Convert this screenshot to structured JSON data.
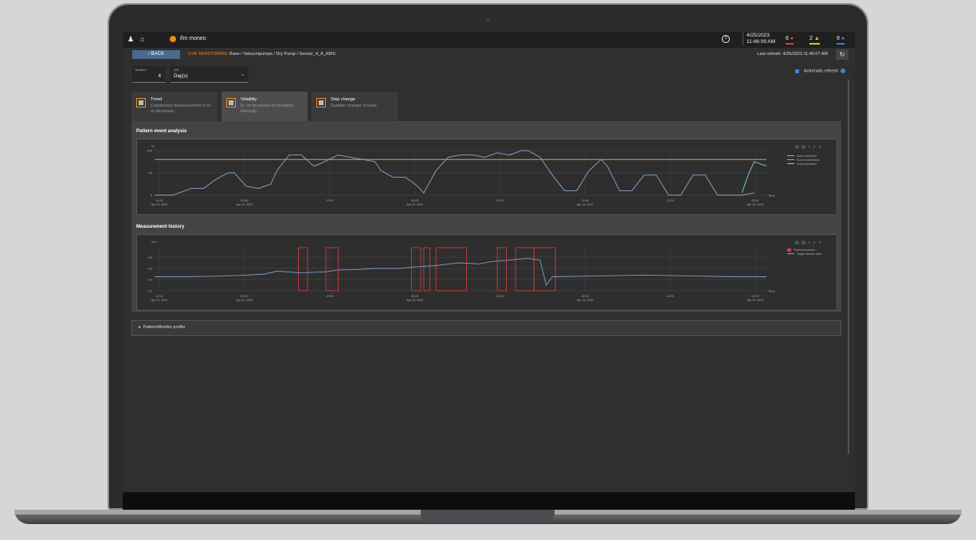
{
  "topbar": {
    "app_name": "ifm moneo",
    "date": "4/25/2023",
    "time": "11:46:09 AM",
    "alarm_red_count": "6",
    "alarm_yellow_count": "2",
    "alarm_blue_count": "9"
  },
  "subbar": {
    "back_label": "BACK",
    "live_label": "LIVE MONITORING:",
    "path": "Base / Vakuumpumpe / Dry Pump / Sensor_4_A_RMS",
    "last_refresh": "Last refresh: 4/25/2023 11:46:07 AM"
  },
  "filters": {
    "duration_label": "Duration*",
    "duration_value": "4",
    "unit_label": "Unit",
    "unit_value": "Day(s)",
    "auto_refresh_label": "Automatic refresh"
  },
  "tabs": [
    {
      "title": "Trend",
      "desc": "Continuous measurement of in- or decrease."
    },
    {
      "title": "Volatility",
      "desc": "In- or decrease of deviation intensity."
    },
    {
      "title": "Step change",
      "desc": "Sudden change of level."
    }
  ],
  "pattern_section": {
    "title": "Pattern event analysis"
  },
  "history_section": {
    "title": "Measurement history"
  },
  "profile": {
    "label": "PatternMonitor profile"
  },
  "icons": {
    "user": "user-icon",
    "home": "home-icon",
    "help": "help-icon",
    "alarm_red": "bell-icon",
    "alarm_yellow": "warning-icon",
    "alarm_blue": "info-icon",
    "back": "chevron-left-icon",
    "refresh": "refresh-icon",
    "tab": "pattern-icon",
    "expand": "triangle-right-icon"
  },
  "colors": {
    "accent": "#f08a1c",
    "alarm_threshold": "#e8a21c",
    "event_confirmation": "#8fa8c8",
    "event_prediction": "#7fd0e0",
    "threshold_alarms": "#e23b3b",
    "target_variable": "#7d9cc9"
  },
  "chart_data": [
    {
      "type": "line",
      "title": "Pattern event analysis",
      "ylabel": "%",
      "xlabel": "Time",
      "ylim": [
        0,
        100
      ],
      "yticks": [
        "100",
        "50",
        "0"
      ],
      "xticks": [
        {
          "time": "12:00",
          "date": "Apr 21, 2023"
        },
        {
          "time": "00:00",
          "date": "Apr 22, 2023"
        },
        {
          "time": "12:00",
          "date": ""
        },
        {
          "time": "00:00",
          "date": "Apr 23, 2023"
        },
        {
          "time": "12:00",
          "date": ""
        },
        {
          "time": "00:00",
          "date": "Apr 24, 2023"
        },
        {
          "time": "12:00",
          "date": ""
        },
        {
          "time": "00:00",
          "date": "Apr 25, 2023"
        }
      ],
      "legend": [
        "Alarm threshold",
        "Event confirmation",
        "Event prediction"
      ],
      "alarm_threshold": 80,
      "series": [
        {
          "name": "Event confirmation",
          "x": [
            0,
            3,
            6,
            8,
            10,
            12,
            13,
            15,
            17,
            19,
            20,
            22,
            24,
            26,
            27,
            30,
            32,
            34,
            36,
            37,
            39,
            41,
            43,
            44,
            46,
            48,
            50,
            52,
            54,
            56,
            58,
            60,
            61,
            63,
            65,
            67,
            69,
            71,
            73,
            74,
            76,
            78,
            80,
            82,
            84,
            86,
            88,
            90,
            92,
            94,
            96,
            98
          ],
          "values": [
            0,
            0,
            15,
            15,
            35,
            50,
            50,
            20,
            15,
            25,
            55,
            90,
            90,
            65,
            70,
            90,
            85,
            80,
            75,
            55,
            40,
            40,
            20,
            5,
            55,
            85,
            90,
            90,
            85,
            95,
            90,
            100,
            100,
            85,
            45,
            10,
            10,
            55,
            80,
            65,
            10,
            10,
            45,
            45,
            0,
            0,
            45,
            45,
            0,
            0,
            0,
            5
          ]
        },
        {
          "name": "Event prediction",
          "x": [
            96,
            97,
            98,
            99,
            100
          ],
          "values": [
            5,
            45,
            75,
            70,
            65
          ]
        }
      ]
    },
    {
      "type": "line",
      "title": "Measurement history",
      "ylabel": "m/s",
      "xlabel": "Time",
      "ylim": [
        0.2,
        1.0
      ],
      "yticks": [
        "0.8",
        "0.6",
        "0.4",
        "0.2"
      ],
      "xticks": [
        {
          "time": "12:00",
          "date": "Apr 21, 2023"
        },
        {
          "time": "00:00",
          "date": "Apr 22, 2023"
        },
        {
          "time": "12:00",
          "date": ""
        },
        {
          "time": "00:00",
          "date": "Apr 23, 2023"
        },
        {
          "time": "12:00",
          "date": ""
        },
        {
          "time": "00:00",
          "date": "Apr 24, 2023"
        },
        {
          "time": "12:00",
          "date": ""
        },
        {
          "time": "00:00",
          "date": "Apr 25, 2023"
        }
      ],
      "legend": [
        "Threshold alarms",
        "Target variable data"
      ],
      "series": [
        {
          "name": "Target variable data",
          "x": [
            0,
            5,
            10,
            15,
            18,
            20,
            24,
            28,
            30,
            33,
            36,
            40,
            43,
            46,
            48,
            50,
            53,
            55,
            58,
            61,
            63,
            64,
            65,
            70,
            75,
            80,
            85,
            90,
            95,
            100
          ],
          "values": [
            0.45,
            0.45,
            0.46,
            0.48,
            0.5,
            0.55,
            0.52,
            0.54,
            0.57,
            0.58,
            0.6,
            0.6,
            0.63,
            0.65,
            0.68,
            0.7,
            0.68,
            0.72,
            0.75,
            0.78,
            0.75,
            0.3,
            0.45,
            0.46,
            0.47,
            0.48,
            0.47,
            0.46,
            0.45,
            0.45
          ]
        },
        {
          "name": "Threshold alarms",
          "x": [],
          "values": []
        }
      ],
      "alarm_windows": [
        [
          23.5,
          25
        ],
        [
          28,
          30
        ],
        [
          42,
          43.5
        ],
        [
          44,
          45
        ],
        [
          46,
          51
        ],
        [
          56,
          57.5
        ],
        [
          59,
          62
        ],
        [
          62,
          65.5
        ]
      ]
    }
  ]
}
